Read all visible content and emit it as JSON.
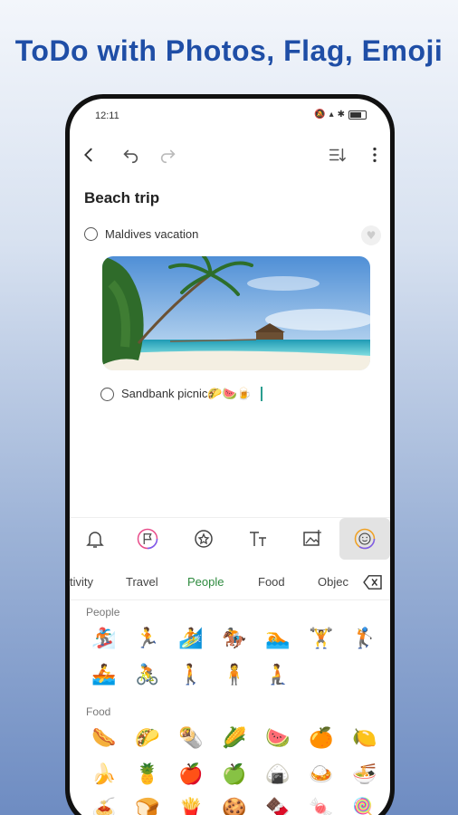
{
  "headline": "ToDo with Photos, Flag, Emoji",
  "status_bar": {
    "time": "12:11"
  },
  "note": {
    "title": "Beach trip",
    "items": [
      {
        "text": "Maldives vacation"
      },
      {
        "text": "Sandbank picnic🌮🍉🍺"
      }
    ]
  },
  "format_bar": {
    "icons": [
      "bell-icon",
      "flag-icon",
      "star-icon",
      "text-size-icon",
      "image-icon",
      "emoji-icon"
    ],
    "active": "emoji-icon"
  },
  "emoji_panel": {
    "categories": [
      "tivity",
      "Travel",
      "People",
      "Food",
      "Objec"
    ],
    "active_category": "People",
    "sections": [
      {
        "label": "People",
        "rows": [
          [
            "🏂",
            "🏃",
            "🏄",
            "🏇",
            "🏊",
            "🏋",
            "🏌"
          ],
          [
            "🚣",
            "🚴",
            "🚶",
            "🧍",
            "🧎"
          ]
        ]
      },
      {
        "label": "Food",
        "rows": [
          [
            "🌭",
            "🌮",
            "🌯",
            "🌽",
            "🍉",
            "🍊",
            "🍋"
          ],
          [
            "🍌",
            "🍍",
            "🍎",
            "🍏",
            "🍙",
            "🍛",
            "🍜"
          ],
          [
            "🍝",
            "🍞",
            "🍟",
            "🍪",
            "🍫",
            "🍬",
            "🍭"
          ]
        ]
      }
    ]
  },
  "colors": {
    "headline": "#1f4ea6",
    "active_category": "#2e8b3f",
    "phone_frame": "#111111"
  }
}
